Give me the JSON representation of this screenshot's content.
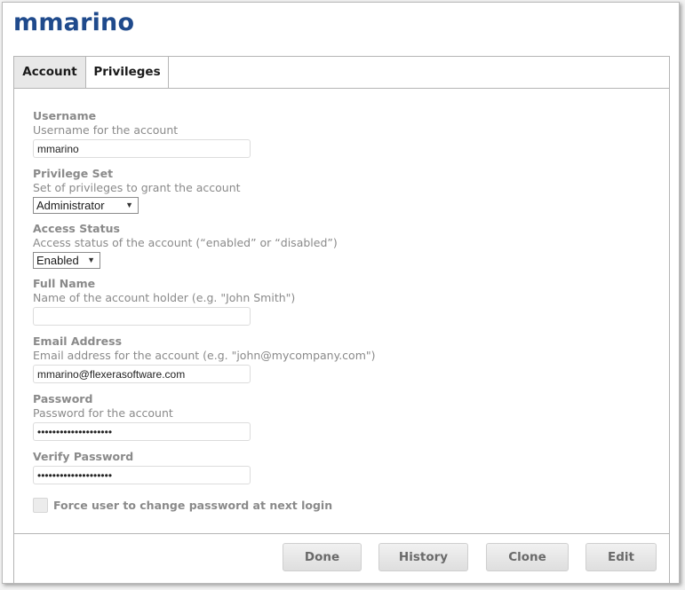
{
  "page": {
    "title": "mmarino"
  },
  "tabs": [
    {
      "label": "Account",
      "active": true
    },
    {
      "label": "Privileges",
      "active": false
    }
  ],
  "fields": {
    "username": {
      "label": "Username",
      "description": "Username for the account",
      "value": "mmarino"
    },
    "privilege_set": {
      "label": "Privilege Set",
      "description": "Set of privileges to grant the account",
      "selected": "Administrator"
    },
    "access_status": {
      "label": "Access Status",
      "description": "Access status of the account (“enabled” or “disabled”)",
      "selected": "Enabled"
    },
    "full_name": {
      "label": "Full Name",
      "description": "Name of the account holder (e.g. \"John Smith\")",
      "value": ""
    },
    "email": {
      "label": "Email Address",
      "description": "Email address for the account (e.g. \"john@mycompany.com\")",
      "value": "mmarino@flexerasoftware.com"
    },
    "password": {
      "label": "Password",
      "description": "Password for the account",
      "value": "••••••••••••••••••••"
    },
    "verify_password": {
      "label": "Verify Password",
      "value": "••••••••••••••••••••"
    },
    "force_change": {
      "label": "Force user to change password at next login",
      "checked": false
    }
  },
  "buttons": {
    "done": "Done",
    "history": "History",
    "clone": "Clone",
    "edit": "Edit"
  },
  "colors": {
    "title": "#1f4a8c",
    "label": "#8a8a8a",
    "active_tab_bg": "#e8e8e8"
  }
}
